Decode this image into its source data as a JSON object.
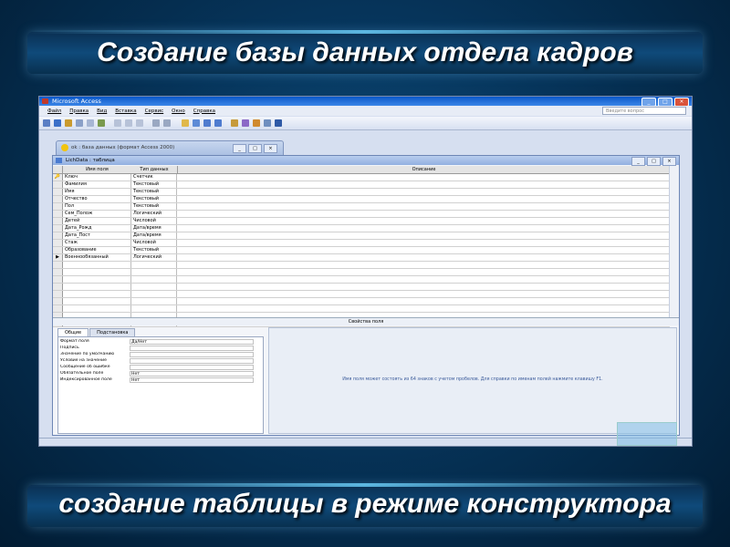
{
  "slide": {
    "title": "Создание базы данных отдела кадров",
    "subtitle": "создание таблицы в режиме конструктора"
  },
  "app": {
    "window_title": "Microsoft Access",
    "menu": [
      "Файл",
      "Правка",
      "Вид",
      "Вставка",
      "Сервис",
      "Окно",
      "Справка"
    ],
    "ask_placeholder": "Введите вопрос"
  },
  "db_window": {
    "title": "ok : база данных (формат Access 2000)"
  },
  "table_window": {
    "title": "LichData : таблица",
    "columns": {
      "field": "Имя поля",
      "type": "Тип данных",
      "description": "Описание"
    },
    "rows": [
      {
        "marker": "🔑",
        "field": "Ключ",
        "type": "Счетчик"
      },
      {
        "marker": "",
        "field": "Фамилия",
        "type": "Текстовый"
      },
      {
        "marker": "",
        "field": "Имя",
        "type": "Текстовый"
      },
      {
        "marker": "",
        "field": "Отчество",
        "type": "Текстовый"
      },
      {
        "marker": "",
        "field": "Пол",
        "type": "Текстовый"
      },
      {
        "marker": "",
        "field": "Сем_Полож",
        "type": "Логический"
      },
      {
        "marker": "",
        "field": "Детей",
        "type": "Числовой"
      },
      {
        "marker": "",
        "field": "Дата_Рожд",
        "type": "Дата/время"
      },
      {
        "marker": "",
        "field": "Дата_Пост",
        "type": "Дата/время"
      },
      {
        "marker": "",
        "field": "Стаж",
        "type": "Числовой"
      },
      {
        "marker": "",
        "field": "Образование",
        "type": "Текстовый"
      },
      {
        "marker": "▶",
        "field": "Военнообязанный",
        "type": "Логический"
      }
    ],
    "properties_label": "Свойства поля",
    "tabs": [
      "Общие",
      "Подстановка"
    ],
    "properties": [
      {
        "label": "Формат поля",
        "value": "Да/Нет"
      },
      {
        "label": "Подпись",
        "value": ""
      },
      {
        "label": "Значение по умолчанию",
        "value": ""
      },
      {
        "label": "Условие на значение",
        "value": ""
      },
      {
        "label": "Сообщение об ошибке",
        "value": ""
      },
      {
        "label": "Обязательное поле",
        "value": "Нет"
      },
      {
        "label": "Индексированное поле",
        "value": "Нет"
      }
    ],
    "help_text": "Имя поля может состоять из 64 знаков с учетом пробелов.  Для справки по именам полей нажмите клавишу F1."
  }
}
